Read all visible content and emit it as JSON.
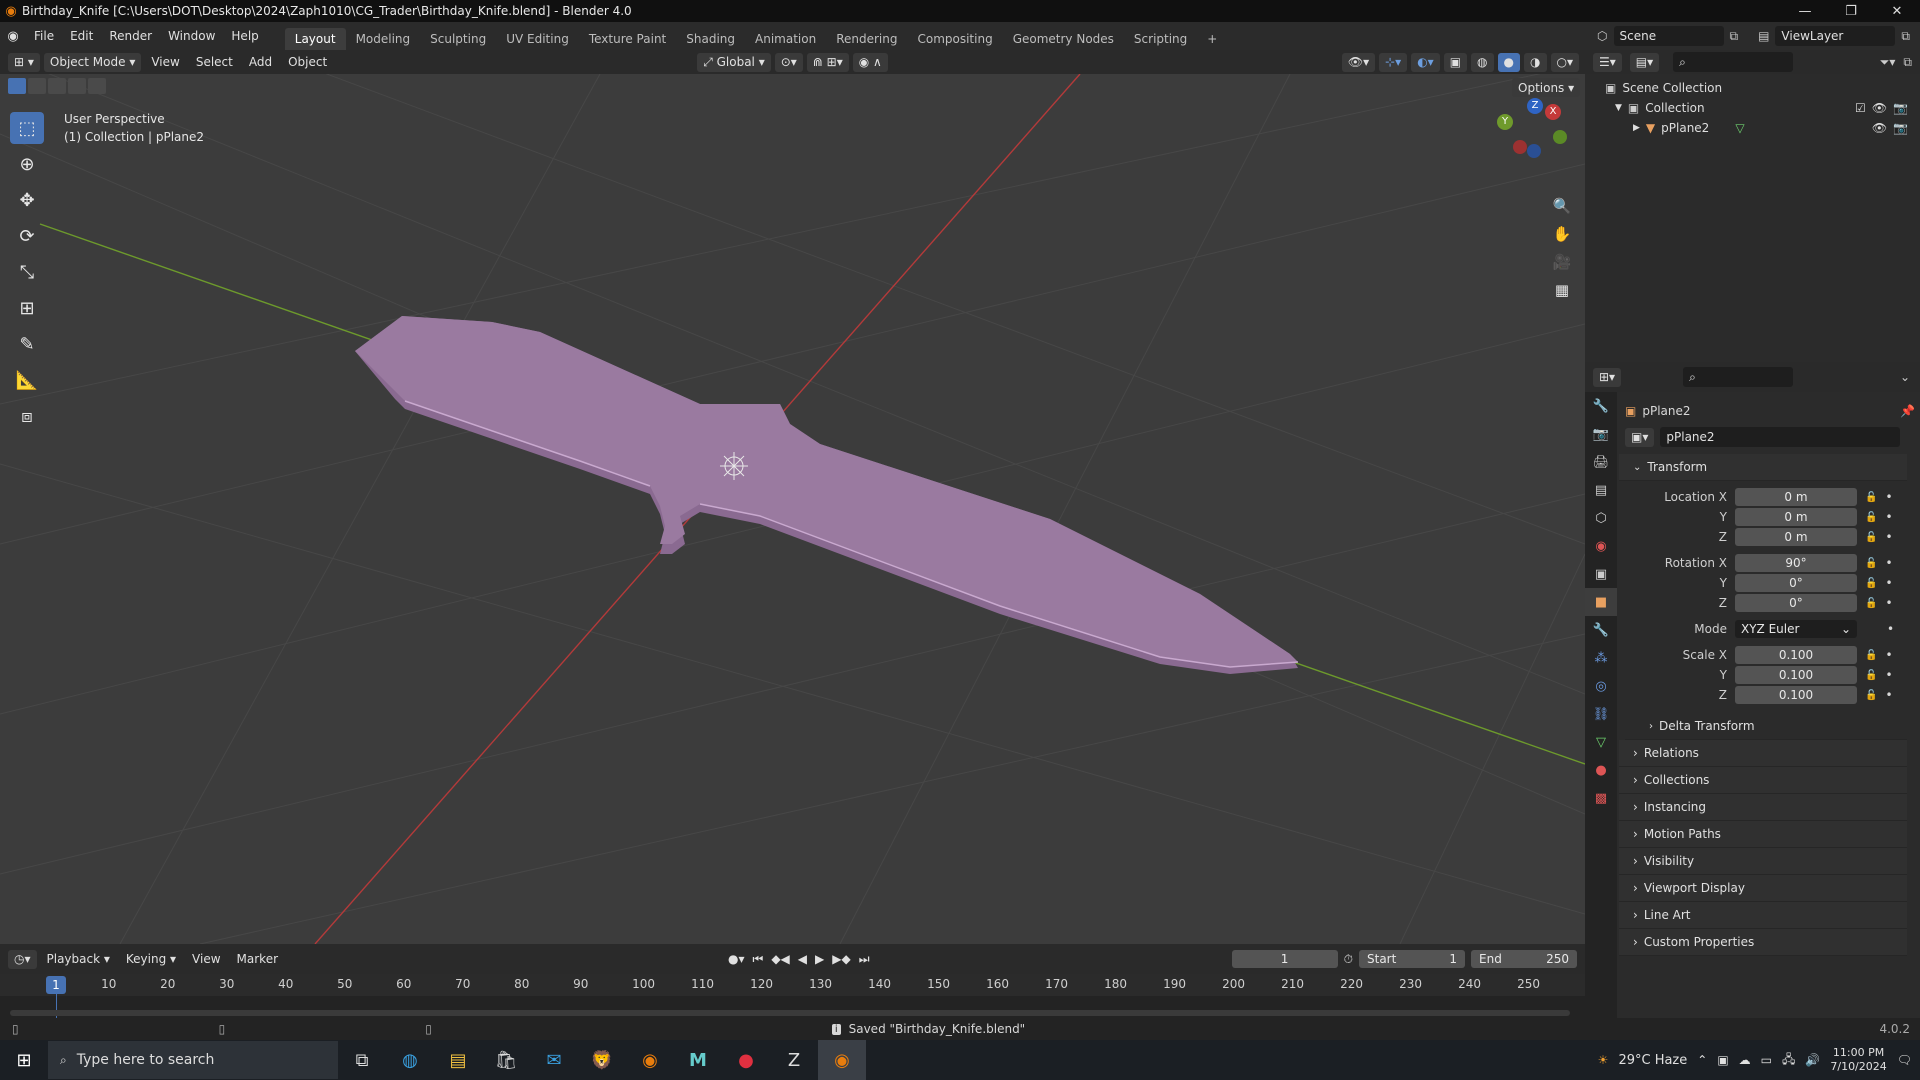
{
  "window": {
    "title": "Birthday_Knife [C:\\Users\\DOT\\Desktop\\2024\\Zaph1010\\CG_Trader\\Birthday_Knife.blend] - Blender 4.0",
    "min": "—",
    "max": "❐",
    "close": "✕"
  },
  "menu": [
    "File",
    "Edit",
    "Render",
    "Window",
    "Help"
  ],
  "workspaces": [
    "Layout",
    "Modeling",
    "Sculpting",
    "UV Editing",
    "Texture Paint",
    "Shading",
    "Animation",
    "Rendering",
    "Compositing",
    "Geometry Nodes",
    "Scripting"
  ],
  "active_workspace": "Layout",
  "add_workspace": "+",
  "scene": "Scene",
  "view_layer": "ViewLayer",
  "viewport_header": {
    "mode": "Object Mode",
    "menus": [
      "View",
      "Select",
      "Add",
      "Object"
    ],
    "orientation": "Global",
    "options": "Options"
  },
  "viewport": {
    "perspective": "User Perspective",
    "collection_line": "(1) Collection | pPlane2",
    "gizmo": {
      "x": "X",
      "y": "Y",
      "z": "Z"
    }
  },
  "outliner": {
    "scene_collection": "Scene Collection",
    "collection": "Collection",
    "object": "pPlane2"
  },
  "properties": {
    "object_name": "pPlane2",
    "data_name": "pPlane2",
    "transform_title": "Transform",
    "location_label": "Location X",
    "location": [
      "0 m",
      "0 m",
      "0 m"
    ],
    "rotation_label": "Rotation X",
    "rotation": [
      "90°",
      "0°",
      "0°"
    ],
    "mode_label": "Mode",
    "mode_value": "XYZ Euler",
    "scale_label": "Scale X",
    "scale": [
      "0.100",
      "0.100",
      "0.100"
    ],
    "axis_y": "Y",
    "axis_z": "Z",
    "delta_transform": "Delta Transform",
    "panels": [
      "Relations",
      "Collections",
      "Instancing",
      "Motion Paths",
      "Visibility",
      "Viewport Display",
      "Line Art",
      "Custom Properties"
    ]
  },
  "timeline": {
    "menus": [
      "Playback",
      "Keying",
      "View",
      "Marker"
    ],
    "current_frame": "1",
    "start_label": "Start",
    "start": "1",
    "end_label": "End",
    "end": "250",
    "ticks": [
      "10",
      "20",
      "30",
      "40",
      "50",
      "60",
      "70",
      "80",
      "90",
      "100",
      "110",
      "120",
      "130",
      "140",
      "150",
      "160",
      "170",
      "180",
      "190",
      "200",
      "210",
      "220",
      "230",
      "240",
      "250"
    ],
    "playhead": "1"
  },
  "status": {
    "message": "Saved \"Birthday_Knife.blend\"",
    "version": "4.0.2"
  },
  "taskbar": {
    "search_placeholder": "Type here to search",
    "weather": "29°C  Haze",
    "time": "11:00 PM",
    "date": "7/10/2024"
  },
  "colors": {
    "knife": "#9a7aa0",
    "accent": "#4772b3",
    "x_axis": "#b33a3a",
    "y_axis": "#6d9a2c"
  }
}
